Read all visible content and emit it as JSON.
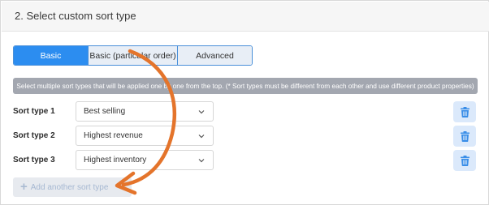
{
  "section": {
    "title": "2. Select custom sort type"
  },
  "tabs": [
    {
      "label": "Basic",
      "active": true
    },
    {
      "label": "Basic (particular order)",
      "active": false
    },
    {
      "label": "Advanced",
      "active": false
    }
  ],
  "info_text": "Select multiple sort types that will be applied one by one from the top. (* Sort types must be different from each other and use different product properties)",
  "sort_types": [
    {
      "label": "Sort type 1",
      "value": "Best selling"
    },
    {
      "label": "Sort type 2",
      "value": "Highest revenue"
    },
    {
      "label": "Sort type 3",
      "value": "Highest inventory"
    }
  ],
  "add_button": {
    "icon": "plus-icon",
    "label": "Add another sort type"
  },
  "colors": {
    "accent": "#2c8df0",
    "arrow": "#e4742b",
    "delete_icon": "#3a8ee8"
  }
}
